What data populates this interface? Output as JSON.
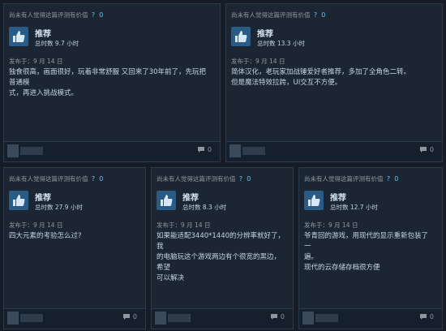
{
  "reviews": [
    {
      "helpful_text": "尚未有人觉得这篇评测有价值",
      "helpful_count": "0",
      "rating_label": "推荐",
      "hours": "总时数 9.7 小时",
      "posted": "发布于：9 月 14 日",
      "text_lines": [
        "独食很高，画面很好，玩着非常舒服 又回来了30年前了，先玩把普通模",
        "式，再进入挑战模式。"
      ],
      "comment_count": "0"
    },
    {
      "helpful_text": "尚未有人觉得这篇评测有价值",
      "helpful_count": "0",
      "rating_label": "推荐",
      "hours": "总时数 13.3 小时",
      "posted": "发布于：9 月 14 日",
      "text_lines": [
        "简体汉化，老玩家加战锤爱好者推荐，多加了全角色二转。",
        "但是魔法特效拉跨，UI交互不方便。"
      ],
      "comment_count": "0"
    },
    {
      "helpful_text": "尚未有人觉得这篇评测有价值",
      "helpful_count": "0",
      "rating_label": "推荐",
      "hours": "总时数 27.9 小时",
      "posted": "发布于：9 月 14 日",
      "text_lines": [
        "四大元素的考验怎么过?"
      ],
      "comment_count": "0"
    },
    {
      "helpful_text": "尚未有人觉得这篇评测有价值",
      "helpful_count": "0",
      "rating_label": "推荐",
      "hours": "总时数 8.3 小时",
      "posted": "发布于：9 月 14 日",
      "text_lines": [
        "如果能适配3440*1440的分辨率就好了，我",
        "的电脑玩这个游戏两边有个很宽的黑边，希望",
        "可以解决"
      ],
      "comment_count": "0"
    },
    {
      "helpful_text": "尚未有人觉得这篇评测有价值",
      "helpful_count": "0",
      "rating_label": "推荐",
      "hours": "总时数 12.7 小时",
      "posted": "发布于：9 月 14 日",
      "text_lines": [
        "爷青回的游戏，用现代的显示重新包装了一",
        "遍。",
        "现代的云存储存档很方便"
      ],
      "comment_count": "0"
    }
  ],
  "icons": {
    "thumb": "thumbs-up-icon",
    "comment": "comment-icon",
    "help": "question-icon"
  },
  "colors": {
    "accent": "#66c0f4",
    "card": "#1c2633",
    "thumb_bg": "#2a5a86"
  }
}
